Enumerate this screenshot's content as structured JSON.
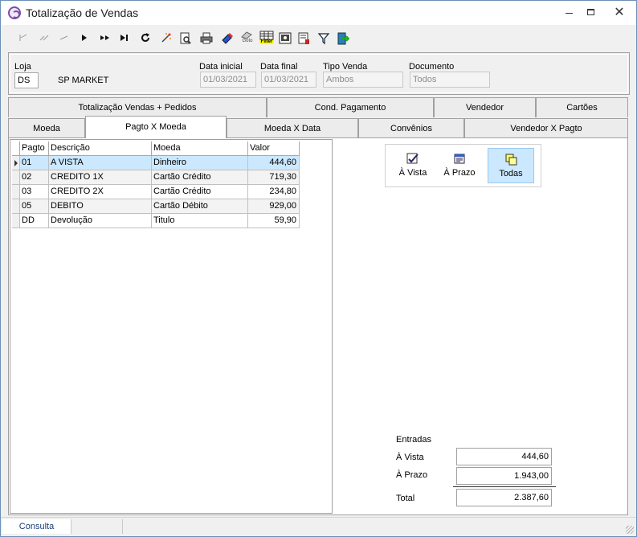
{
  "window": {
    "title": "Totalização de Vendas",
    "close_label": "✕"
  },
  "toolbar": {
    "icons": [
      "first-icon",
      "prior-page-icon",
      "prior-icon",
      "next-icon",
      "next-page-icon",
      "last-icon",
      "refresh-icon",
      "wand-icon",
      "preview-icon",
      "print-icon",
      "export-icon",
      "goto-icon",
      "filter-grid-icon",
      "screen-icon",
      "save-icon",
      "funnel-icon",
      "exit-icon"
    ],
    "goto_label": "Goto",
    "filter_label": "Filter"
  },
  "filters": {
    "loja_label": "Loja",
    "loja_value": "DS",
    "loja_name": "SP MARKET",
    "data_inicial_label": "Data inicial",
    "data_inicial_value": "01/03/2021",
    "data_final_label": "Data final",
    "data_final_value": "01/03/2021",
    "tipo_venda_label": "Tipo Venda",
    "tipo_venda_value": "Ambos",
    "documento_label": "Documento",
    "documento_value": "Todos"
  },
  "tabs_row1": [
    "Totalização Vendas + Pedidos",
    "Cond. Pagamento",
    "Vendedor",
    "Cartões"
  ],
  "tabs_row2": [
    "Moeda",
    "Pagto X Moeda",
    "Moeda X Data",
    "Convênios",
    "Vendedor X Pagto"
  ],
  "active_tab": "Pagto X Moeda",
  "grid": {
    "columns": [
      "Pagto",
      "Descrição",
      "Moeda",
      "Valor"
    ],
    "rows": [
      {
        "pagto": "01",
        "descricao": "A VISTA",
        "moeda": "Dinheiro",
        "valor": "444,60"
      },
      {
        "pagto": "02",
        "descricao": "CREDITO 1X",
        "moeda": "Cartão Crédito",
        "valor": "719,30"
      },
      {
        "pagto": "03",
        "descricao": "CREDITO 2X",
        "moeda": "Cartão Crédito",
        "valor": "234,80"
      },
      {
        "pagto": "05",
        "descricao": "DEBITO",
        "moeda": "Cartão Débito",
        "valor": "929,00"
      },
      {
        "pagto": "DD",
        "descricao": "Devolução",
        "moeda": "Titulo",
        "valor": "59,90"
      }
    ]
  },
  "view_buttons": {
    "a_vista": "À Vista",
    "a_prazo": "À Prazo",
    "todas": "Todas",
    "selected": "Todas"
  },
  "totals": {
    "header": "Entradas",
    "a_vista_label": "À Vista",
    "a_vista_value": "444,60",
    "a_prazo_label": "À Prazo",
    "a_prazo_value": "1.943,00",
    "total_label": "Total",
    "total_value": "2.387,60"
  },
  "status": {
    "mode": "Consulta"
  }
}
